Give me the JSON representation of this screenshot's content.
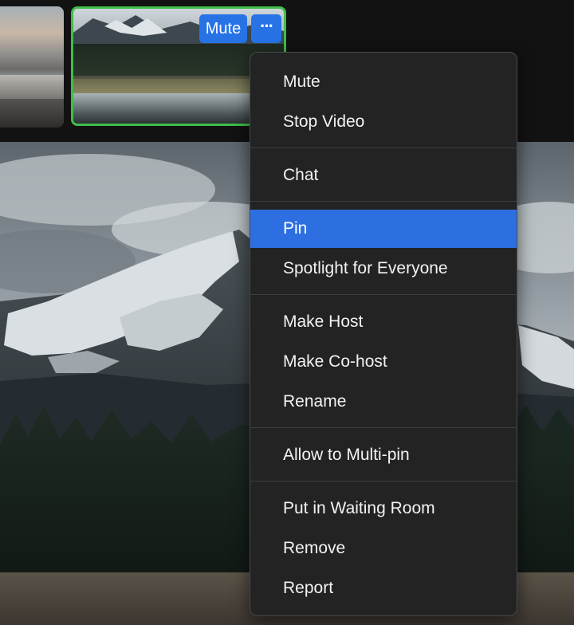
{
  "video_tile": {
    "mute_label": "Mute",
    "more_label": "···",
    "more_icon": "ellipsis-icon",
    "active_border_color": "#3fbe4a",
    "button_color": "#2773e6"
  },
  "menu": {
    "items": [
      {
        "label": "Mute"
      },
      {
        "label": "Stop Video"
      },
      {
        "label": "Chat"
      },
      {
        "label": "Pin"
      },
      {
        "label": "Spotlight for Everyone"
      },
      {
        "label": "Make Host"
      },
      {
        "label": "Make Co-host"
      },
      {
        "label": "Rename"
      },
      {
        "label": "Allow to Multi-pin"
      },
      {
        "label": "Put in Waiting Room"
      },
      {
        "label": "Remove"
      },
      {
        "label": "Report"
      }
    ],
    "highlight_color": "#2d6fe0"
  }
}
